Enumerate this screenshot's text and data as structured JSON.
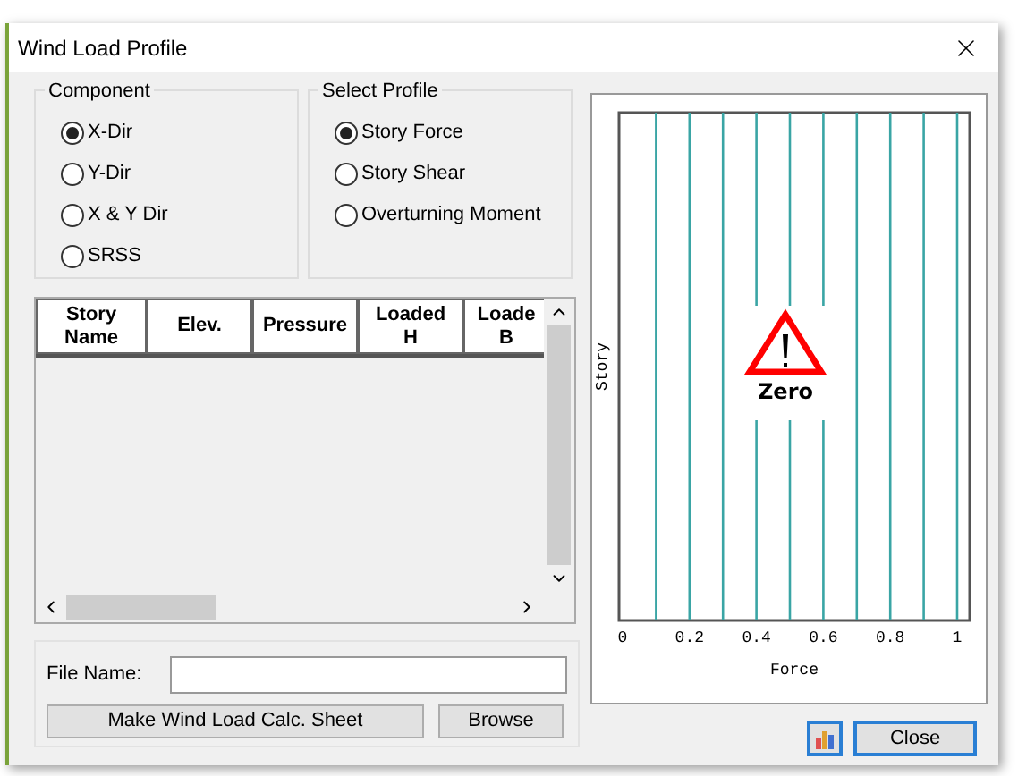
{
  "window": {
    "title": "Wind Load Profile"
  },
  "component": {
    "title": "Component",
    "options": [
      {
        "label": "X-Dir",
        "selected": true
      },
      {
        "label": "Y-Dir",
        "selected": false
      },
      {
        "label": "X & Y Dir",
        "selected": false
      },
      {
        "label": "SRSS",
        "selected": false
      }
    ]
  },
  "select_profile": {
    "title": "Select Profile",
    "options": [
      {
        "label": "Story Force",
        "selected": true
      },
      {
        "label": "Story Shear",
        "selected": false
      },
      {
        "label": "Overturning Moment",
        "selected": false
      }
    ]
  },
  "table": {
    "columns": [
      "Story Name",
      "Elev.",
      "Pressure",
      "Loaded H",
      "Loade B"
    ]
  },
  "file": {
    "label": "File Name:",
    "buttons": [
      "Make Wind Load Calc. Sheet",
      "Browse"
    ]
  },
  "chart": {
    "xlabel": "Force",
    "ylabel": "Story",
    "xticks": [
      "0",
      "0.2",
      "0.4",
      "0.6",
      "0.8",
      "1"
    ],
    "message": "Zero"
  },
  "buttons": [
    "Close"
  ]
}
